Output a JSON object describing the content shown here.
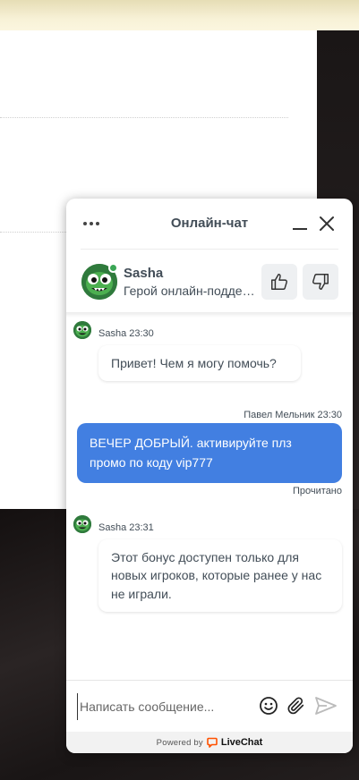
{
  "chat": {
    "title": "Онлайн-чат",
    "agent": {
      "name": "Sasha",
      "role": "Герой онлайн-поддержки"
    },
    "messages": [
      {
        "direction": "incoming",
        "meta": "Sasha 23:30",
        "text": "Привет! Чем я могу помочь?"
      },
      {
        "direction": "outgoing",
        "meta": "Павел Мельник 23:30",
        "text": "ВЕЧЕР ДОБРЫЙ. активируйте плз промо по коду vip777",
        "status": "Прочитано"
      },
      {
        "direction": "incoming",
        "meta": "Sasha 23:31",
        "text": "Этот бонус доступен только для новых игроков, которые ранее у нас не играли."
      }
    ],
    "composer": {
      "placeholder": "Написать сообщение...",
      "value": ""
    },
    "footer": {
      "powered_by": "Powered by",
      "brand": "LiveChat"
    }
  },
  "colors": {
    "accent": "#427fe1",
    "text": "#424d57",
    "online": "#3aa655",
    "brand": "#ff5100"
  },
  "icons": [
    "menu-dots-icon",
    "minimize-icon",
    "close-icon",
    "thumbs-up-icon",
    "thumbs-down-icon",
    "emoji-icon",
    "attachment-icon",
    "send-icon",
    "livechat-logo-icon"
  ]
}
